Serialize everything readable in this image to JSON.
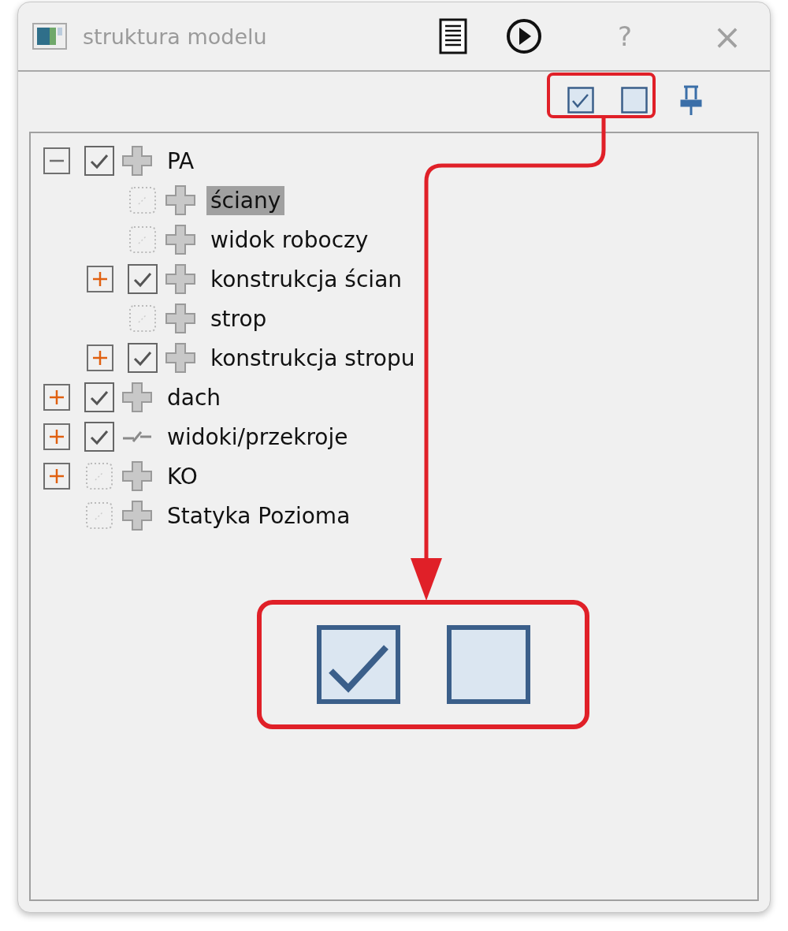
{
  "window": {
    "title": "struktura modelu",
    "buttons": [
      "?",
      "×"
    ]
  },
  "tree": [
    {
      "label": "PA",
      "kind": "cross",
      "checked": true,
      "disabled": false,
      "expanded": true,
      "selected": false,
      "children": [
        {
          "label": "ściany",
          "kind": "cross",
          "checked": false,
          "disabled": true,
          "selected": true
        },
        {
          "label": "widok roboczy",
          "kind": "cross",
          "checked": false,
          "disabled": true,
          "selected": false
        },
        {
          "label": "konstrukcja ścian",
          "kind": "cross",
          "checked": true,
          "disabled": false,
          "expanded": false,
          "selected": false
        },
        {
          "label": "strop",
          "kind": "cross",
          "checked": false,
          "disabled": true,
          "selected": false
        },
        {
          "label": "konstrukcja stropu",
          "kind": "cross",
          "checked": true,
          "disabled": false,
          "expanded": false,
          "selected": false
        }
      ]
    },
    {
      "label": "dach",
      "kind": "cross",
      "checked": true,
      "disabled": false,
      "expanded": false,
      "selected": false
    },
    {
      "label": "widoki/przekroje",
      "kind": "section",
      "checked": true,
      "disabled": false,
      "expanded": false,
      "selected": false
    },
    {
      "label": "KO",
      "kind": "cross",
      "checked": false,
      "disabled": true,
      "expanded": false,
      "selected": false
    },
    {
      "label": "Statyka Pozioma",
      "kind": "cross",
      "checked": false,
      "disabled": true,
      "selected": false
    }
  ]
}
